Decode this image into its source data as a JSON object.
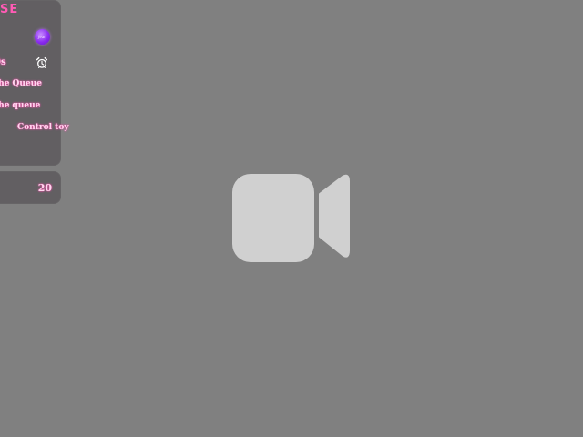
{
  "panel": {
    "title": "SE",
    "avatar_text": "Jean",
    "timer_text": "0s",
    "queue_line_1": "the Queue",
    "queue_line_2": "the queue",
    "control_text": "Control toy"
  },
  "counter": {
    "value": "20"
  },
  "icons": {
    "alarm": "alarm-clock-icon",
    "video": "video-camera-icon"
  },
  "colors": {
    "background": "#808080",
    "accent": "#ff5bb5",
    "text_glow": "#ff4fb0",
    "avatar": "#8b2cf0",
    "video_icon": "#d0d0d0"
  }
}
